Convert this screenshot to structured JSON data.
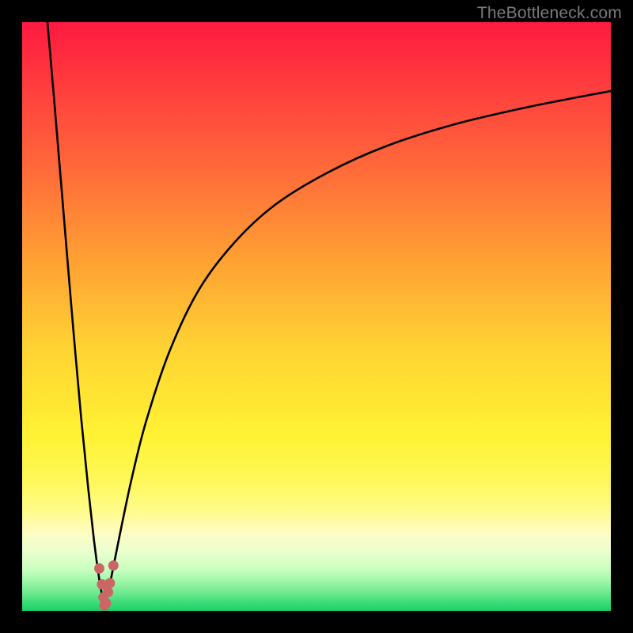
{
  "watermark": "TheBottleneck.com",
  "chart_data": {
    "type": "line",
    "title": "",
    "xlabel": "",
    "ylabel": "",
    "xlim": [
      0,
      100
    ],
    "ylim": [
      0,
      100
    ],
    "legend": false,
    "grid": false,
    "background": "heat-gradient (red top → green bottom)",
    "series": [
      {
        "name": "left-branch",
        "description": "steep descending curve from top-left down to the valley",
        "x": [
          4.3,
          5.5,
          7.0,
          8.5,
          10.0,
          11.2,
          12.2,
          13.0,
          13.6,
          14.0
        ],
        "y": [
          100,
          86,
          68,
          50,
          33,
          21,
          12,
          6,
          2.5,
          0.5
        ]
      },
      {
        "name": "right-branch",
        "description": "curve rising from valley asymptotically toward ~88% at right edge",
        "x": [
          14.0,
          15.0,
          16.5,
          18.5,
          21.0,
          25.0,
          30.0,
          36.0,
          43.0,
          52.0,
          62.0,
          74.0,
          87.0,
          100.0
        ],
        "y": [
          0.5,
          5.0,
          12.5,
          22.0,
          32.0,
          44.0,
          54.5,
          62.5,
          69.0,
          74.5,
          79.0,
          82.8,
          85.8,
          88.3
        ]
      }
    ],
    "markers": [
      {
        "series": "left-branch",
        "x": 13.1,
        "y": 7.2
      },
      {
        "series": "left-branch",
        "x": 13.55,
        "y": 4.5
      },
      {
        "series": "left-branch",
        "x": 13.8,
        "y": 2.3
      },
      {
        "series": "left-branch",
        "x": 13.95,
        "y": 0.9
      },
      {
        "series": "right-branch",
        "x": 14.25,
        "y": 1.3
      },
      {
        "series": "right-branch",
        "x": 14.6,
        "y": 3.2
      },
      {
        "series": "right-branch",
        "x": 14.9,
        "y": 4.7
      },
      {
        "series": "right-branch",
        "x": 15.5,
        "y": 7.7
      }
    ],
    "valley_x": 14.0,
    "notes": "No numeric axis ticks or labels are rendered in the image; values above are estimated from pixel positions on a 0–100 normalized plot area."
  },
  "colors": {
    "frame": "#000000",
    "curve": "#000000",
    "marker": "#cc6666",
    "watermark": "#7a7a7a"
  }
}
